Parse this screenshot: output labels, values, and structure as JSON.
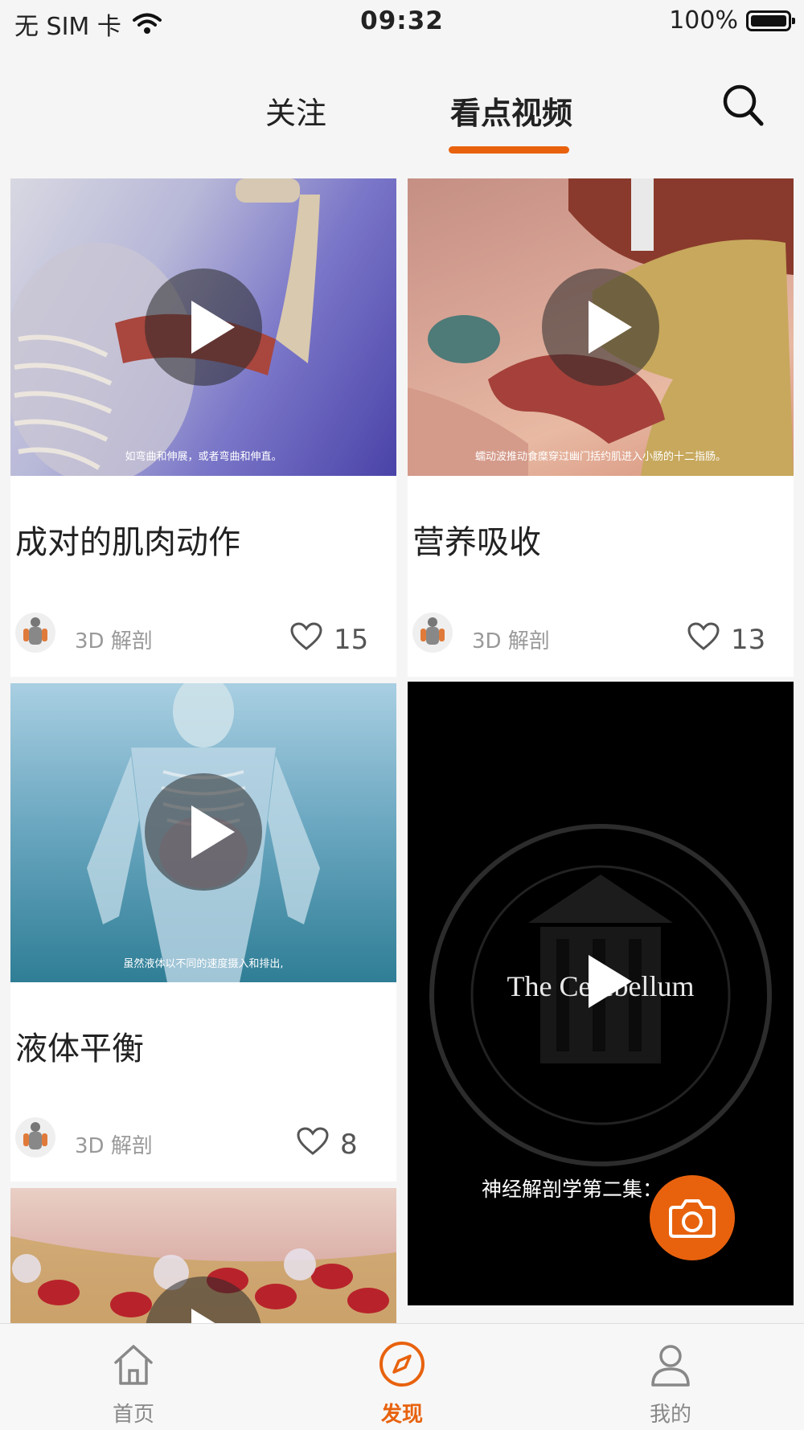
{
  "status_bar": {
    "carrier": "无 SIM 卡",
    "time": "09:32",
    "battery": "100%"
  },
  "top_nav": {
    "tabs": [
      {
        "label": "关注",
        "active": false
      },
      {
        "label": "看点视频",
        "active": true
      }
    ],
    "search_icon": "search-icon"
  },
  "videos": [
    {
      "title": "成对的肌肉动作",
      "subtitle": "如弯曲和伸展，或者弯曲和伸直。",
      "author": "3D 解剖",
      "likes": "15"
    },
    {
      "title": "营养吸收",
      "subtitle": "蠕动波推动食糜穿过幽门括约肌进入小肠的十二指肠。",
      "author": "3D 解剖",
      "likes": "13"
    },
    {
      "title": "液体平衡",
      "subtitle": "虽然液体以不同的速度摄入和排出,",
      "author": "3D 解剖",
      "likes": "8"
    },
    {
      "overlay_title": "The Cerebellum",
      "caption": "神经解剖学第二集："
    }
  ],
  "fab": {
    "icon": "camera-icon"
  },
  "bottom_nav": [
    {
      "label": "首页",
      "icon": "home-icon",
      "active": false
    },
    {
      "label": "发现",
      "icon": "compass-icon",
      "active": true
    },
    {
      "label": "我的",
      "icon": "user-icon",
      "active": false
    }
  ],
  "colors": {
    "accent": "#e8620e",
    "background": "#f5f5f5"
  }
}
